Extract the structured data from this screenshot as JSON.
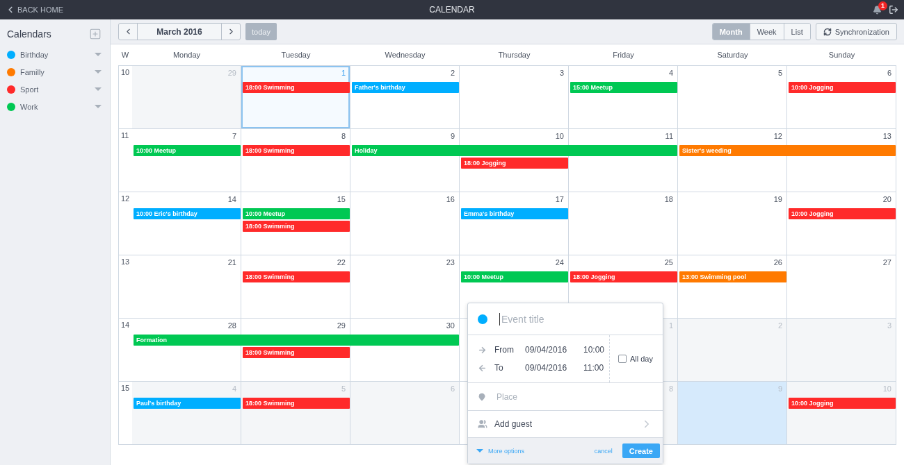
{
  "top_bar": {
    "back": "BACK HOME",
    "title": "CALENDAR",
    "notifications": "1"
  },
  "sidebar": {
    "title": "Calendars",
    "calendars": [
      {
        "name": "Birthday",
        "color": "#00aeff"
      },
      {
        "name": "Familly",
        "color": "#ff7a00"
      },
      {
        "name": "Sport",
        "color": "#ff2a2a"
      },
      {
        "name": "Work",
        "color": "#00c853"
      }
    ]
  },
  "toolbar": {
    "month": "March 2016",
    "today_button": {
      "label": "today",
      "disabled": true
    },
    "views": [
      {
        "label": "Month",
        "selected": true
      },
      {
        "label": "Week",
        "selected": false
      },
      {
        "label": "List",
        "selected": false
      }
    ],
    "sync": "Synchronization"
  },
  "calendar": {
    "week_label": "W",
    "day_names": [
      "Monday",
      "Tuesday",
      "Wednesday",
      "Thursday",
      "Friday",
      "Saturday",
      "Sunday"
    ],
    "weeks": [
      {
        "number": "10",
        "days": [
          {
            "number": "29",
            "outside": true,
            "today": false,
            "selected": false
          },
          {
            "number": "1",
            "outside": false,
            "today": true,
            "selected": false,
            "events": [
              {
                "kind": "event",
                "label": "18:00 Swimming",
                "color": "#ff2a2a"
              }
            ]
          },
          {
            "number": "2",
            "outside": false,
            "today": false,
            "selected": false,
            "events": [
              {
                "kind": "event",
                "label": "Father's birthday",
                "color": "#00aeff"
              }
            ]
          },
          {
            "number": "3",
            "outside": false,
            "today": false,
            "selected": false
          },
          {
            "number": "4",
            "outside": false,
            "today": false,
            "selected": false,
            "events": [
              {
                "kind": "event",
                "label": "15:00 Meetup",
                "color": "#00c853"
              }
            ]
          },
          {
            "number": "5",
            "outside": false,
            "today": false,
            "selected": false
          },
          {
            "number": "6",
            "outside": false,
            "today": false,
            "selected": false,
            "events": [
              {
                "kind": "event",
                "label": "10:00 Jogging",
                "color": "#ff2a2a"
              }
            ]
          }
        ]
      },
      {
        "number": "11",
        "days": [
          {
            "number": "7",
            "outside": false,
            "today": false,
            "selected": false,
            "events": [
              {
                "kind": "event",
                "label": "10:00 Meetup",
                "color": "#00c853"
              }
            ]
          },
          {
            "number": "8",
            "outside": false,
            "today": false,
            "selected": false,
            "events": [
              {
                "kind": "event",
                "label": "18:00 Swimming",
                "color": "#ff2a2a"
              }
            ]
          },
          {
            "number": "9",
            "outside": false,
            "today": false,
            "selected": false,
            "events": [
              {
                "kind": "event",
                "label": "Holiday",
                "color": "#00c853"
              }
            ]
          },
          {
            "number": "10",
            "outside": false,
            "today": false,
            "selected": false,
            "events": [
              {
                "kind": "continued"
              },
              {
                "kind": "event",
                "label": "18:00 Jogging",
                "color": "#ff2a2a"
              }
            ]
          },
          {
            "number": "11",
            "outside": false,
            "today": false,
            "selected": false,
            "events": [
              {
                "kind": "continued"
              }
            ]
          },
          {
            "number": "12",
            "outside": false,
            "today": false,
            "selected": false,
            "events": [
              {
                "kind": "event",
                "label": "Sister's weeding",
                "color": "#ff7a00"
              }
            ]
          },
          {
            "number": "13",
            "outside": false,
            "today": false,
            "selected": false,
            "events": [
              {
                "kind": "continued"
              }
            ]
          }
        ]
      },
      {
        "number": "12",
        "days": [
          {
            "number": "14",
            "outside": false,
            "today": false,
            "selected": false,
            "events": [
              {
                "kind": "event",
                "label": "10:00 Eric's birthday",
                "color": "#00aeff"
              }
            ]
          },
          {
            "number": "15",
            "outside": false,
            "today": false,
            "selected": false,
            "events": [
              {
                "kind": "event",
                "label": "10:00 Meetup",
                "color": "#00c853"
              },
              {
                "kind": "event",
                "label": "18:00 Swimming",
                "color": "#ff2a2a"
              }
            ]
          },
          {
            "number": "16",
            "outside": false,
            "today": false,
            "selected": false
          },
          {
            "number": "17",
            "outside": false,
            "today": false,
            "selected": false,
            "events": [
              {
                "kind": "event",
                "label": "Emma's birthday",
                "color": "#00aeff"
              }
            ]
          },
          {
            "number": "18",
            "outside": false,
            "today": false,
            "selected": false
          },
          {
            "number": "19",
            "outside": false,
            "today": false,
            "selected": false
          },
          {
            "number": "20",
            "outside": false,
            "today": false,
            "selected": false,
            "events": [
              {
                "kind": "event",
                "label": "10:00 Jogging",
                "color": "#ff2a2a"
              }
            ]
          }
        ]
      },
      {
        "number": "13",
        "days": [
          {
            "number": "21",
            "outside": false,
            "today": false,
            "selected": false
          },
          {
            "number": "22",
            "outside": false,
            "today": false,
            "selected": false,
            "events": [
              {
                "kind": "event",
                "label": "18:00 Swimming",
                "color": "#ff2a2a"
              }
            ]
          },
          {
            "number": "23",
            "outside": false,
            "today": false,
            "selected": false
          },
          {
            "number": "24",
            "outside": false,
            "today": false,
            "selected": false,
            "events": [
              {
                "kind": "event",
                "label": "10:00 Meetup",
                "color": "#00c853"
              }
            ]
          },
          {
            "number": "25",
            "outside": false,
            "today": false,
            "selected": false,
            "events": [
              {
                "kind": "event",
                "label": "18:00 Jogging",
                "color": "#ff2a2a"
              }
            ]
          },
          {
            "number": "26",
            "outside": false,
            "today": false,
            "selected": false,
            "events": [
              {
                "kind": "event",
                "label": "13:00 Swimming pool",
                "color": "#ff7a00"
              }
            ]
          },
          {
            "number": "27",
            "outside": false,
            "today": false,
            "selected": false
          }
        ]
      },
      {
        "number": "14",
        "days": [
          {
            "number": "28",
            "outside": false,
            "today": false,
            "selected": false,
            "events": [
              {
                "kind": "event",
                "label": "Formation",
                "color": "#00c853"
              }
            ]
          },
          {
            "number": "29",
            "outside": false,
            "today": false,
            "selected": false,
            "events": [
              {
                "kind": "continued"
              },
              {
                "kind": "event",
                "label": "18:00 Swimming",
                "color": "#ff2a2a"
              }
            ]
          },
          {
            "number": "30",
            "outside": false,
            "today": false,
            "selected": false,
            "events": [
              {
                "kind": "continued"
              }
            ]
          },
          {
            "today": false,
            "selected": false
          },
          {
            "number": "1",
            "outside": true,
            "today": false,
            "selected": false
          },
          {
            "number": "2",
            "outside": true,
            "today": false,
            "selected": false
          },
          {
            "number": "3",
            "outside": true,
            "today": false,
            "selected": false
          }
        ]
      },
      {
        "number": "15",
        "days": [
          {
            "number": "4",
            "outside": true,
            "today": false,
            "selected": false,
            "events": [
              {
                "kind": "event",
                "label": "Paul's birthday",
                "color": "#00aeff"
              }
            ]
          },
          {
            "number": "5",
            "outside": true,
            "today": false,
            "selected": false,
            "events": [
              {
                "kind": "event",
                "label": "18:00 Swimming",
                "color": "#ff2a2a"
              }
            ]
          },
          {
            "number": "6",
            "outside": true,
            "today": false,
            "selected": false
          },
          {
            "today": false,
            "selected": false
          },
          {
            "number": "8",
            "outside": true,
            "today": false,
            "selected": false
          },
          {
            "number": "9",
            "outside": true,
            "today": false,
            "selected": true
          },
          {
            "number": "10",
            "outside": true,
            "today": false,
            "selected": false,
            "events": [
              {
                "kind": "event",
                "label": "10:00 Jogging",
                "color": "#ff2a2a"
              }
            ]
          }
        ]
      }
    ]
  },
  "new_event": {
    "color": "#00aeff",
    "title_placeholder": "Event title",
    "from": {
      "label": "From",
      "date": "09/04/2016",
      "time": "10:00"
    },
    "to": {
      "label": "To",
      "date": "09/04/2016",
      "time": "11:00"
    },
    "all_day": {
      "label": "All day",
      "checked": false
    },
    "place_placeholder": "Place",
    "guest": "Add guest",
    "more_options": "More options",
    "cancel": "cancel",
    "create": "Create"
  }
}
